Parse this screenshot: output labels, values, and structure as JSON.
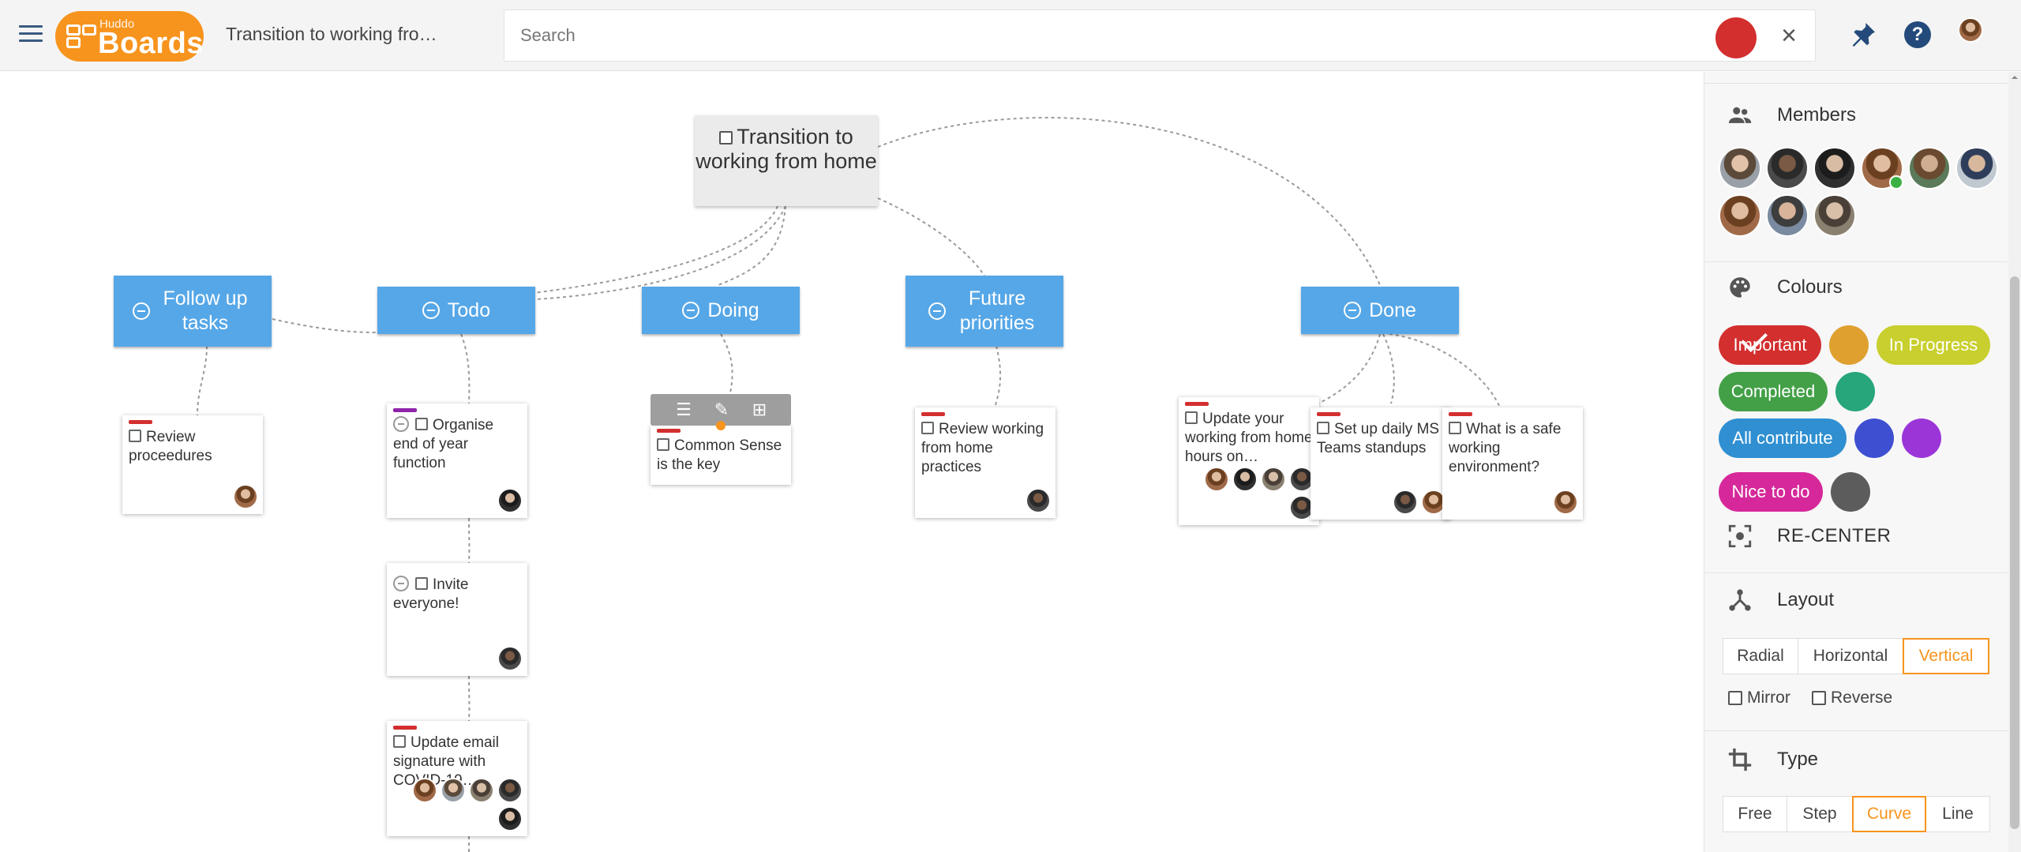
{
  "header": {
    "logo_small": "Huddo",
    "logo_big": "Boards",
    "board_title": "Transition to working fro…",
    "search_placeholder": "Search",
    "clear_symbol": "×",
    "help_symbol": "?"
  },
  "map": {
    "root": "Transition to working from home",
    "columns": [
      {
        "label": "Follow up tasks"
      },
      {
        "label": "Todo"
      },
      {
        "label": "Doing"
      },
      {
        "label": "Future priorities"
      },
      {
        "label": "Done"
      }
    ],
    "cards": [
      {
        "text": "Review proceedures",
        "tag": "red",
        "members": 1
      },
      {
        "text": "Organise end of year function",
        "tag": "purple",
        "members": 1
      },
      {
        "text": "Invite everyone!",
        "tag": "none",
        "members": 1
      },
      {
        "text": "Update email signature with COVID-19…",
        "tag": "red",
        "members": 5
      },
      {
        "text": "Common Sense is the key",
        "tag": "red",
        "members": 0
      },
      {
        "text": "Review working from home practices",
        "tag": "red",
        "members": 1
      },
      {
        "text": "Update your working from home hours on…",
        "tag": "red",
        "members": 5
      },
      {
        "text": "Set up daily MS Teams standups",
        "tag": "red",
        "members": 2
      },
      {
        "text": "What is a safe working environment?",
        "tag": "red",
        "members": 1
      }
    ],
    "toolbar_icons": [
      "add-list-icon",
      "pencil-icon",
      "add-card-icon"
    ]
  },
  "panel": {
    "members_label": "Members",
    "colours_label": "Colours",
    "colours": [
      {
        "label": "Important",
        "color": "#d32f2f",
        "checked": true
      },
      {
        "label": "",
        "color": "#e0a030"
      },
      {
        "label": "In Progress",
        "color": "#c8cf2e"
      },
      {
        "label": "Completed",
        "color": "#43a047"
      },
      {
        "label": "",
        "color": "#26a67a"
      },
      {
        "label": "All contribute",
        "color": "#2f8fd1"
      },
      {
        "label": "",
        "color": "#3f4fd1"
      },
      {
        "label": "",
        "color": "#9b35d8"
      },
      {
        "label": "Nice to do",
        "color": "#d6289a"
      },
      {
        "label": "",
        "color": "#5c5c5c"
      }
    ],
    "recenter_label": "RE-CENTER",
    "layout_label": "Layout",
    "layout_options": [
      "Radial",
      "Horizontal",
      "Vertical"
    ],
    "layout_selected": "Vertical",
    "mirror_label": "Mirror",
    "reverse_label": "Reverse",
    "type_label": "Type",
    "type_options": [
      "Free",
      "Step",
      "Curve",
      "Line"
    ],
    "type_selected": "Curve"
  }
}
